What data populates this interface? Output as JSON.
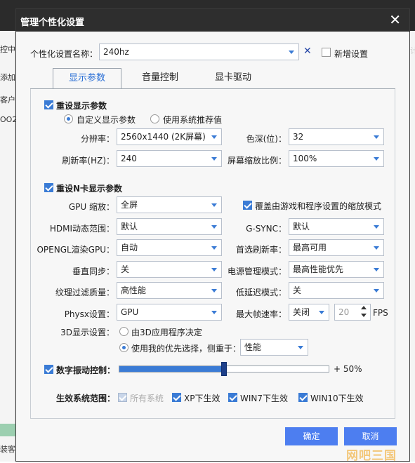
{
  "background": {
    "left_rows": [
      "控中心",
      "添加",
      "客户",
      "OO2",
      "装客户"
    ],
    "right_fragment": "计"
  },
  "dialog": {
    "title": "管理个性化设置",
    "close_glyph": "✕"
  },
  "profile": {
    "label": "个性化设置名称：",
    "value": "240hz",
    "clear_glyph": "✕",
    "new_label": "新增设置"
  },
  "tabs": [
    "显示参数",
    "音量控制",
    "显卡驱动"
  ],
  "display": {
    "reset_label": "重设显示参数",
    "radio_custom": "自定义显示参数",
    "radio_system": "使用系统推荐值",
    "resolution_label": "分辨率：",
    "resolution_value": "2560x1440 (2K屏幕)",
    "color_depth_label": "色深(位)：",
    "color_depth_value": "32",
    "refresh_label": "刷新率(HZ)：",
    "refresh_value": "240",
    "scale_label": "屏幕缩放比例：",
    "scale_value": "100%"
  },
  "nvidia": {
    "reset_label": "重设N卡显示参数",
    "gpu_scale_label": "GPU 缩放：",
    "gpu_scale_value": "全屏",
    "override_label": "覆盖由游戏和程序设置的缩放模式",
    "hdmi_label": "HDMI动态范围：",
    "hdmi_value": "默认",
    "gsync_label": "G-SYNC：",
    "gsync_value": "默认",
    "opengl_label": "OPENGL渲染GPU：",
    "opengl_value": "自动",
    "pref_refresh_label": "首选刷新率：",
    "pref_refresh_value": "最高可用",
    "vsync_label": "垂直同步：",
    "vsync_value": "关",
    "power_label": "电源管理模式：",
    "power_value": "最高性能优先",
    "texture_label": "纹理过滤质量：",
    "texture_value": "高性能",
    "latency_label": "低延迟模式：",
    "latency_value": "关",
    "physx_label": "Physx设置：",
    "physx_value": "GPU",
    "maxfps_label": "最大帧速率：",
    "maxfps_value": "关闭",
    "maxfps_number": "20",
    "fps_unit": "FPS",
    "d3_label": "3D显示设置：",
    "d3_radio_app": "由3D应用程序决定",
    "d3_radio_pref": "使用我的优先选择，侧重于：",
    "d3_pref_value": "性能"
  },
  "vibrance": {
    "label": "数字振动控制：",
    "value_text": "+ 50%",
    "value": 0.5
  },
  "scope": {
    "label": "生效系统范围：",
    "all": "所有系统",
    "xp": "XP下生效",
    "win7": "WIN7下生效",
    "win10": "WIN10下生效"
  },
  "buttons": {
    "ok": "确定",
    "cancel": "取消"
  },
  "watermark": "网吧三国",
  "colors": {
    "accent": "#3a7bd5",
    "titlebar": "#2e2e2e",
    "button": "#4d7ef0"
  }
}
